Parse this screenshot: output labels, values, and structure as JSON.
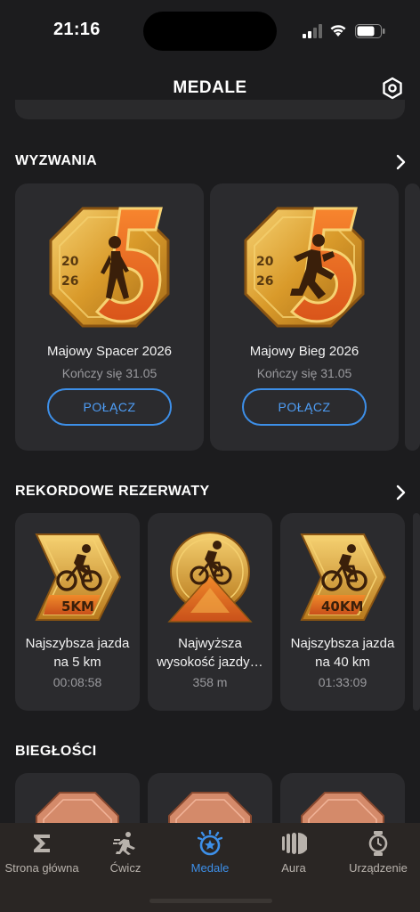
{
  "status": {
    "time": "21:16"
  },
  "header": {
    "title": "MEDALE"
  },
  "sections": {
    "challenges": {
      "title": "WYZWANIA",
      "items": [
        {
          "name": "Majowy Spacer 2026",
          "subtitle": "Kończy się 31.05",
          "button": "POŁĄCZ",
          "medal_year_top": "20",
          "medal_year_bottom": "26"
        },
        {
          "name": "Majowy Bieg 2026",
          "subtitle": "Kończy się 31.05",
          "button": "POŁĄCZ",
          "medal_year_top": "20",
          "medal_year_bottom": "26"
        }
      ]
    },
    "records": {
      "title": "REKORDOWE REZERWATY",
      "items": [
        {
          "name_line1": "Najszybsza jazda",
          "name_line2": "na 5 km",
          "value": "00:08:58",
          "badge": "5KM"
        },
        {
          "name_line1": "Najwyższa",
          "name_line2": "wysokość jazdy…",
          "value": "358 m"
        },
        {
          "name_line1": "Najszybsza jazda",
          "name_line2": "na 40 km",
          "value": "01:33:09",
          "badge": "40KM"
        }
      ]
    },
    "skills": {
      "title": "BIEGŁOŚCI"
    }
  },
  "tabs": [
    {
      "label": "Strona główna",
      "icon": "sigma-icon"
    },
    {
      "label": "Ćwicz",
      "icon": "runner-icon"
    },
    {
      "label": "Medale",
      "icon": "medal-icon",
      "active": true
    },
    {
      "label": "Aura",
      "icon": "aura-icon"
    },
    {
      "label": "Urządzenie",
      "icon": "watch-icon"
    }
  ],
  "colors": {
    "accent": "#3d8fe8",
    "background": "#1c1c1e",
    "card": "#2b2b2e",
    "gold": "#e0a63a",
    "orange": "#e8661c"
  }
}
